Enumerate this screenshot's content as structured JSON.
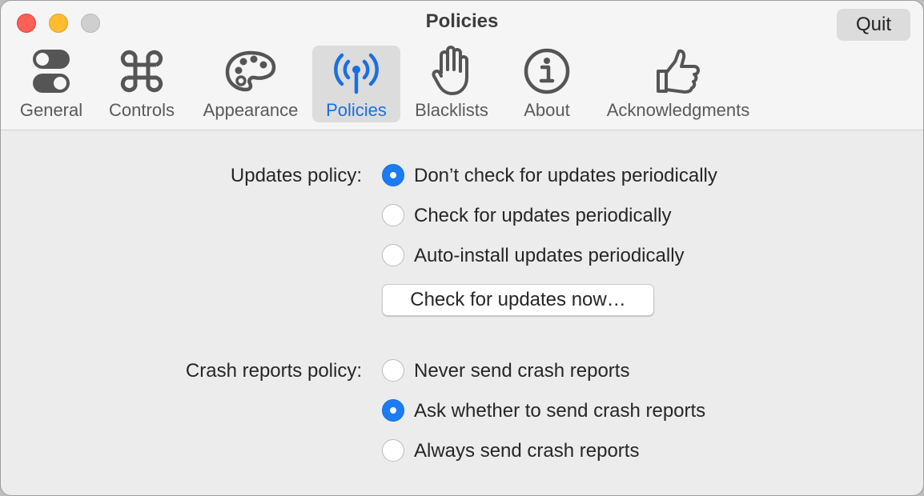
{
  "window": {
    "title": "Policies",
    "quit_label": "Quit"
  },
  "tabs": [
    {
      "label": "General",
      "icon": "toggle-switches-icon"
    },
    {
      "label": "Controls",
      "icon": "command-key-icon"
    },
    {
      "label": "Appearance",
      "icon": "palette-icon"
    },
    {
      "label": "Policies",
      "icon": "antenna-signal-icon",
      "selected": true
    },
    {
      "label": "Blacklists",
      "icon": "raised-hand-icon"
    },
    {
      "label": "About",
      "icon": "info-circle-icon"
    },
    {
      "label": "Acknowledgments",
      "icon": "thumbs-up-icon"
    }
  ],
  "updates": {
    "label": "Updates policy:",
    "options": [
      {
        "label": "Don’t check for updates periodically",
        "selected": true
      },
      {
        "label": "Check for updates periodically",
        "selected": false
      },
      {
        "label": "Auto-install updates periodically",
        "selected": false
      }
    ],
    "check_now_label": "Check for updates now…"
  },
  "crash": {
    "label": "Crash reports policy:",
    "options": [
      {
        "label": "Never send crash reports",
        "selected": false
      },
      {
        "label": "Ask whether to send crash reports",
        "selected": true
      },
      {
        "label": "Always send crash reports",
        "selected": false
      }
    ]
  },
  "colors": {
    "accent": "#1a6fe0",
    "close": "#fe5f57",
    "minimize": "#febc2e",
    "zoom_disabled": "#cfcfcf"
  }
}
